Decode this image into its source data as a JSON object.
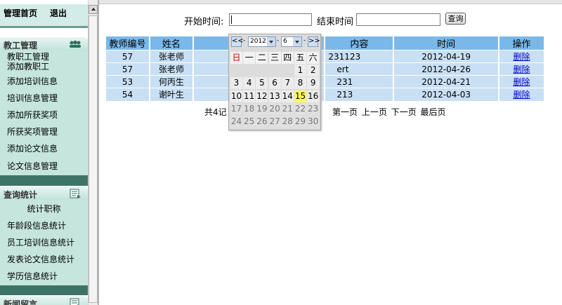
{
  "nav": {
    "home": "管理首页",
    "logout": "退出"
  },
  "sections": [
    {
      "title": "教工管理",
      "items": [
        "教职工管理",
        "添加教职工",
        "添加培训信息",
        "培训信息管理",
        "添加所获奖项",
        "所获奖项管理",
        "添加论文信息",
        "论文信息管理"
      ]
    },
    {
      "title": "查询统计",
      "items": [
        "统计职称",
        "年龄段信息统计",
        "员工培训信息统计",
        "发表论文信息统计",
        "学历信息统计"
      ]
    },
    {
      "title": "新闻留言",
      "items": []
    }
  ],
  "search": {
    "start_label": "开始时间:",
    "end_label": "结束时间",
    "query_button": "查询",
    "start_value": "",
    "end_value": ""
  },
  "table": {
    "headers": [
      "教师编号",
      "姓名",
      "",
      "内容",
      "时间",
      "操作"
    ],
    "rows": [
      {
        "id": "57",
        "name": "张老师",
        "content": "231123",
        "time": "2012-04-19",
        "action": "删除"
      },
      {
        "id": "57",
        "name": "张老师",
        "content": "ert",
        "time": "2012-04-26",
        "action": "删除"
      },
      {
        "id": "53",
        "name": "何丙生",
        "content": "231",
        "time": "2012-04-21",
        "action": "删除"
      },
      {
        "id": "54",
        "name": "谢叶生",
        "content": "213",
        "time": "2012-04-03",
        "action": "删除"
      }
    ]
  },
  "pager": {
    "summary": "共4记",
    "links": [
      "第一页",
      "上一页",
      "下一页",
      "最后页"
    ]
  },
  "datepicker": {
    "prev": "<<",
    "next": ">>",
    "year": "2012",
    "month": "6",
    "weekdays": [
      "日",
      "一",
      "二",
      "三",
      "四",
      "五",
      "六"
    ],
    "today": "15",
    "days": [
      "1",
      "2",
      "3",
      "4",
      "5",
      "6",
      "7",
      "8",
      "9",
      "10",
      "11",
      "12",
      "13",
      "14",
      "15",
      "16",
      "17",
      "18",
      "19",
      "20",
      "21",
      "22",
      "23",
      "24",
      "25",
      "26",
      "27",
      "28",
      "29",
      "30"
    ]
  }
}
